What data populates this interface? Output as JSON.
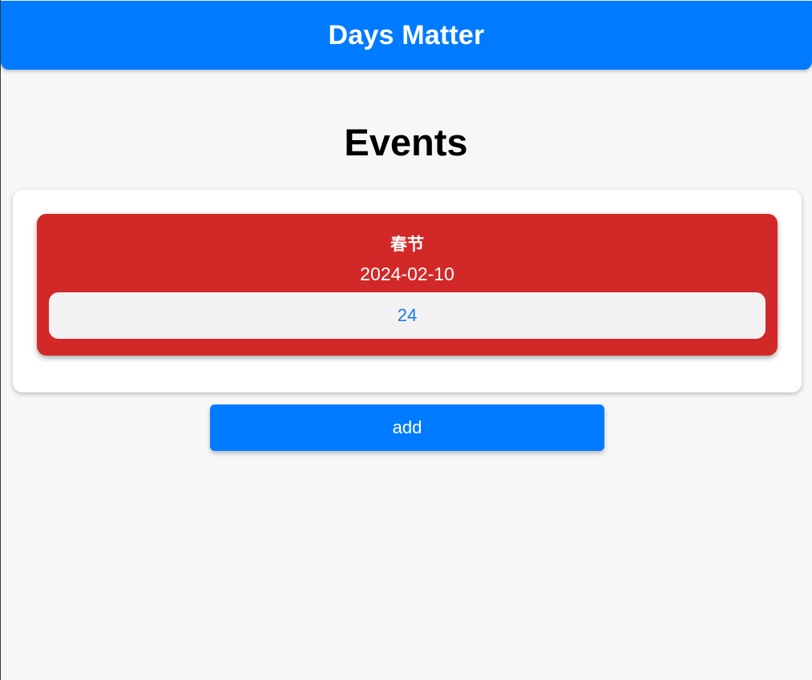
{
  "header": {
    "title": "Days Matter"
  },
  "main": {
    "heading": "Events",
    "events": [
      {
        "name": "春节",
        "date": "2024-02-10",
        "days": "24",
        "color": "#d32828"
      }
    ],
    "add_label": "add"
  },
  "colors": {
    "accent": "#007bff",
    "background": "#f7f7f7",
    "days_text": "#1a7bef"
  }
}
